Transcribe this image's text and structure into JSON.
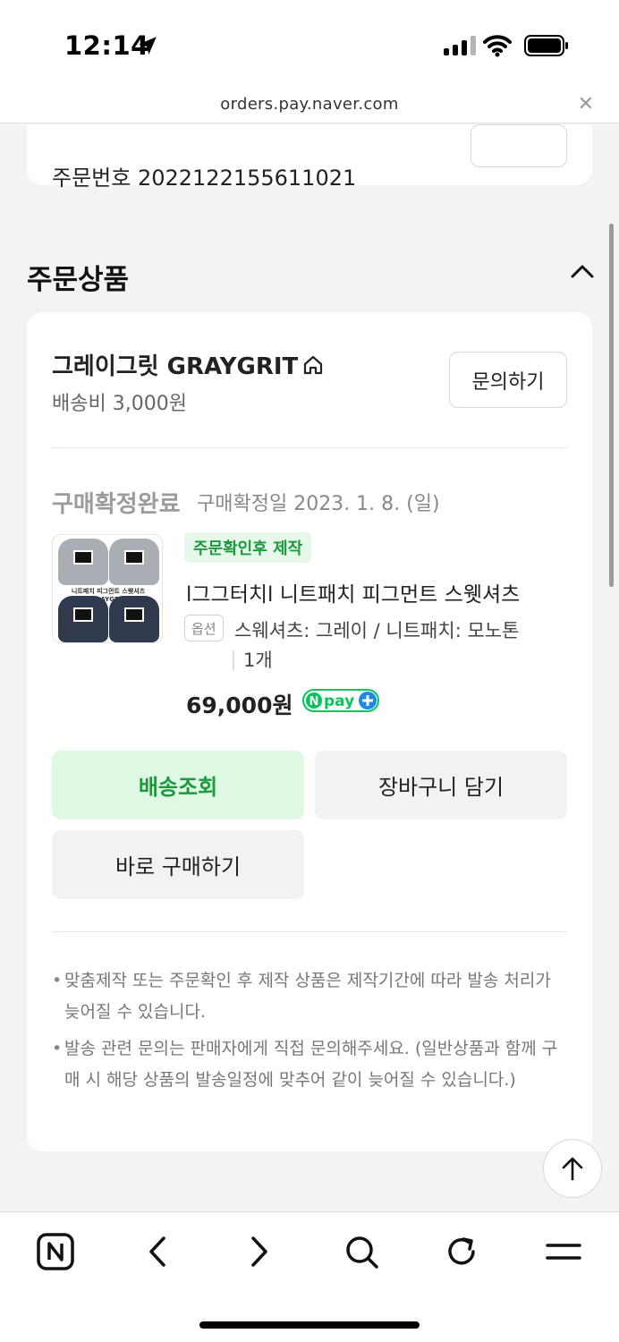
{
  "status_bar": {
    "time": "12:14"
  },
  "url_bar": {
    "url": "orders.pay.naver.com",
    "close_icon": "close-icon"
  },
  "order": {
    "order_number": "주문번호 2022122155611021"
  },
  "section": {
    "title": "주문상품"
  },
  "seller": {
    "name": "그레이그릿 GRAYGRIT",
    "shipping_fee": "배송비 3,000원",
    "inquire_label": "문의하기"
  },
  "item": {
    "status": "구매확정완료",
    "confirm_date": "구매확정일 2023. 1. 8. (일)",
    "badge": "주문확인후 제작",
    "name": "l그그터치l 니트패치 피그먼트 스웻셔츠",
    "option_tag": "옵션",
    "option_value": "스웨셔츠: 그레이 / 니트패치: 모노톤",
    "quantity": "1개",
    "price": "69,000원",
    "thumbnail_text": "니트패치 피그먼트 스웻셔츠 GRAYGRIT"
  },
  "actions": {
    "track_label": "배송조회",
    "cart_label": "장바구니 담기",
    "buy_label": "바로 구매하기"
  },
  "notes": [
    "맞춤제작 또는 주문확인 후 제작 상품은 제작기간에 따라 발송 처리가 늦어질 수 있습니다.",
    "발송 관련 문의는 판매자에게 직접 문의해주세요. (일반상품과 함께 구매 시 해당 상품의 발송일정에 맞추어 같이 늦어질 수 있습니다.)"
  ],
  "colors": {
    "accent_green": "#1d9a3e",
    "accent_green_bg": "#dff8e4",
    "npay_green": "#03c75a",
    "npay_blue": "#1e88e5"
  }
}
